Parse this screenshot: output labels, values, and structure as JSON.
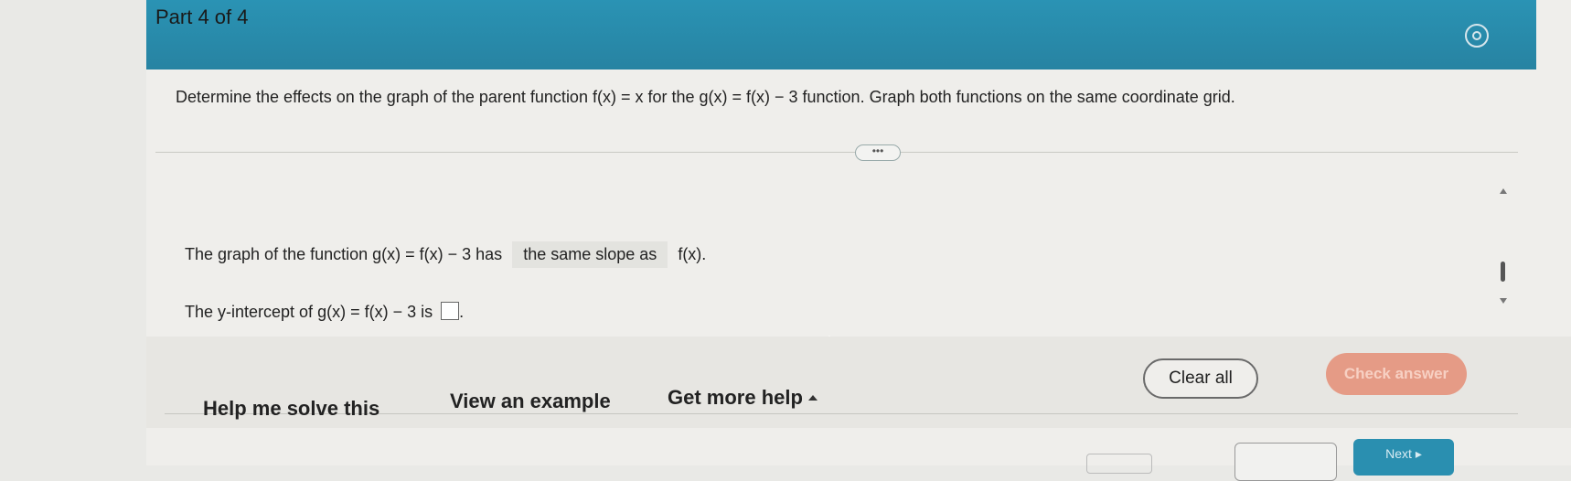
{
  "header": {
    "part_label": "Part 4 of 4"
  },
  "question": {
    "text": "Determine the effects on the graph of the parent function f(x) = x for the g(x) = f(x) − 3 function. Graph both functions on the same coordinate grid."
  },
  "expand": {
    "label": "•••"
  },
  "statements": {
    "slope": {
      "prefix": "The graph of the function g(x) = f(x) − 3 has",
      "selected": "the same slope as",
      "suffix": "f(x)."
    },
    "intercept": {
      "prefix": "The y-intercept of g(x) = f(x) − 3 is",
      "suffix": "."
    }
  },
  "help": {
    "solve": "Help me solve this",
    "example": "View an example",
    "more": "Get more help"
  },
  "buttons": {
    "clear_all": "Clear all",
    "check_answer": "Check answer",
    "next": "Next ▸"
  }
}
